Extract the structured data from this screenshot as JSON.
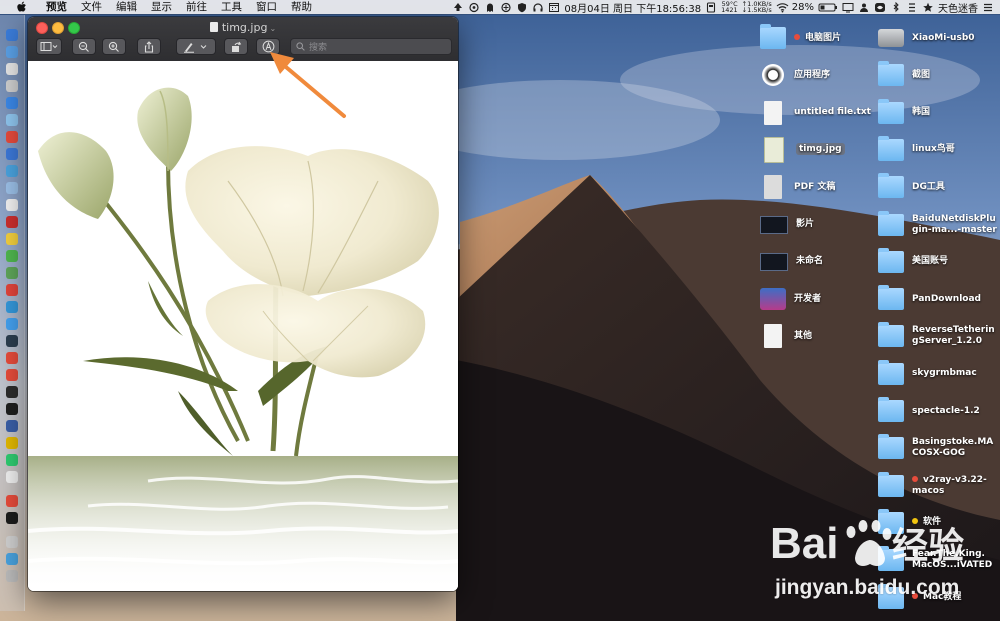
{
  "menubar": {
    "app_name": "预览",
    "menus": [
      "文件",
      "编辑",
      "显示",
      "前往",
      "工具",
      "窗口",
      "帮助"
    ],
    "temperature": "59°C",
    "fan_rpm": "1421",
    "net_up": "↑1.0KB/s",
    "net_down": "↓1.5KB/s",
    "datetime": "08月04日 周日 下午18:56:38",
    "battery": "28%",
    "input_method": "天色迷香"
  },
  "window": {
    "title": "timg.jpg",
    "search_placeholder": "搜索"
  },
  "desktop": {
    "left_column": [
      {
        "label": "电脑图片",
        "icon": "folder-icon",
        "tag": "#e74c3c"
      },
      {
        "label": "应用程序",
        "icon": "applications-icon"
      },
      {
        "label": "untitled file.txt",
        "icon": "text-file-icon"
      },
      {
        "label": "timg.jpg",
        "icon": "image-file-icon",
        "selected": true
      },
      {
        "label": "PDF 文稿",
        "icon": "pdf-folder-icon"
      },
      {
        "label": "影片",
        "icon": "movies-icon"
      },
      {
        "label": "未命名",
        "icon": "untitled-icon"
      },
      {
        "label": "开发者",
        "icon": "developer-icon"
      },
      {
        "label": "其他",
        "icon": "document-icon"
      }
    ],
    "right_column": [
      {
        "label": "XiaoMi-usb0",
        "icon": "drive-icon"
      },
      {
        "label": "截图",
        "icon": "folder-icon"
      },
      {
        "label": "韩国",
        "icon": "folder-icon"
      },
      {
        "label": "linux鸟哥",
        "icon": "folder-icon"
      },
      {
        "label": "DG工具",
        "icon": "folder-icon"
      },
      {
        "label": "BaiduNetdiskPlu\ngin-ma...-master",
        "icon": "folder-icon"
      },
      {
        "label": "美国账号",
        "icon": "folder-icon"
      },
      {
        "label": "PanDownload",
        "icon": "folder-icon"
      },
      {
        "label": "ReverseTetherin\ngServer_1.2.0",
        "icon": "folder-icon"
      },
      {
        "label": "skygrmbmac",
        "icon": "folder-icon"
      },
      {
        "label": "spectacle-1.2",
        "icon": "folder-icon"
      },
      {
        "label": "Basingstoke.MA\nCOSX-GOG",
        "icon": "folder-icon"
      },
      {
        "label": "v2ray-v3.22-\nmacos",
        "icon": "folder-icon",
        "tag": "#e74c3c"
      },
      {
        "label": "软件",
        "icon": "folder-icon",
        "tag": "#f1c40f"
      },
      {
        "label": "Fear.The.King.\nMacOS...iVATED",
        "icon": "folder-icon"
      },
      {
        "label": "Mac教程",
        "icon": "folder-icon",
        "tag": "#e74c3c"
      }
    ]
  },
  "watermark": {
    "brand": "Bai",
    "brand_end": "经验",
    "url": "jingyan.baidu.com"
  },
  "colors": {
    "accent_arrow": "#f08a3c",
    "folder": "#8fc8f6",
    "menubar": "#ececee"
  }
}
